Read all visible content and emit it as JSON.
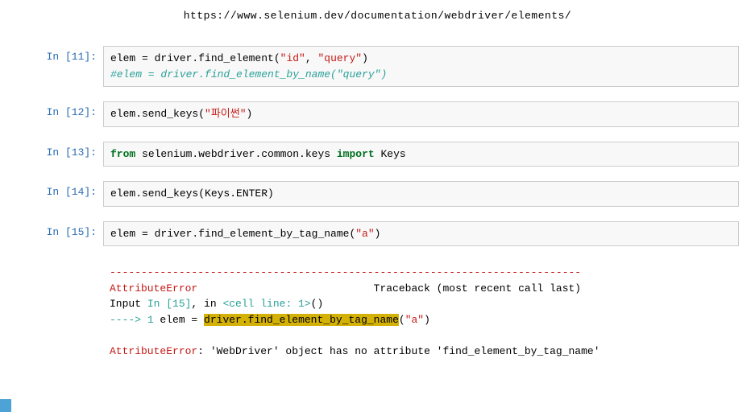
{
  "url": "https://www.selenium.dev/documentation/webdriver/elements/",
  "cells": {
    "c11": {
      "prompt": "In [11]:",
      "line1": {
        "a": "elem = driver.find_element(",
        "s1": "\"id\"",
        "c": ", ",
        "s2": "\"query\"",
        "d": ")"
      },
      "comment": "#elem = driver.find_element_by_name(\"query\")"
    },
    "c12": {
      "prompt": "In [12]:",
      "line": {
        "a": "elem.send_keys(",
        "s": "\"파이썬\"",
        "b": ")"
      }
    },
    "c13": {
      "prompt": "In [13]:",
      "line": {
        "kw1": "from",
        "a": " selenium.webdriver.common.keys ",
        "kw2": "import",
        "b": " Keys"
      }
    },
    "c14": {
      "prompt": "In [14]:",
      "line": "elem.send_keys(Keys.ENTER)"
    },
    "c15": {
      "prompt": "In [15]:",
      "line": {
        "a": "elem = driver.find_element_by_tag_name(",
        "s": "\"a\"",
        "b": ")"
      }
    },
    "error": {
      "sep": "---------------------------------------------------------------------------",
      "name": "AttributeError",
      "tb": "Traceback (most recent call last)",
      "inp_a": "Input ",
      "inp_b": "In [15]",
      "inp_c": ", in ",
      "inp_d": "<cell line: 1>",
      "inp_e": "()",
      "arrow": "----> ",
      "num": "1",
      "code_a": " elem = ",
      "hl": "driver.find_element_by_tag_name",
      "code_b": "(",
      "code_s": "\"a\"",
      "code_c": ")",
      "final_name": "AttributeError",
      "final_msg": ": 'WebDriver' object has no attribute 'find_element_by_tag_name'"
    }
  }
}
